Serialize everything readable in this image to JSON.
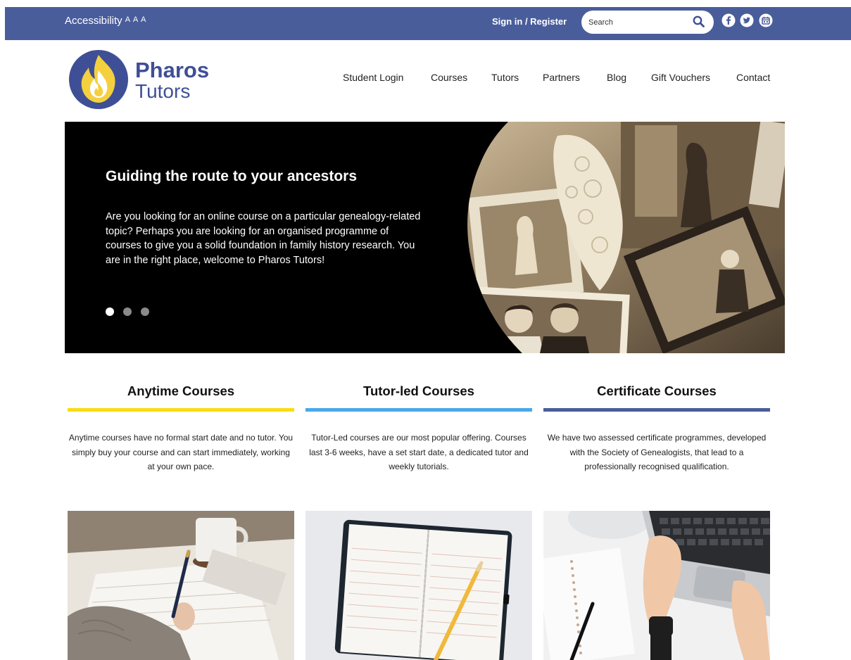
{
  "topbar": {
    "accessibility_label": "Accessibility",
    "font_size_options": "A A A",
    "signin_label": "Sign in / Register",
    "search_placeholder": "Search",
    "background": "#4a5d9b"
  },
  "social": [
    {
      "name": "facebook-icon"
    },
    {
      "name": "twitter-icon"
    },
    {
      "name": "calendar-icon"
    }
  ],
  "logo": {
    "line1": "Pharos",
    "line2": "Tutors",
    "brand_color": "#3f4f96",
    "flame_color": "#f4d03f"
  },
  "nav": {
    "items": [
      "Student Login",
      "Courses",
      "Tutors",
      "Partners",
      "Blog",
      "Gift Vouchers",
      "Contact"
    ]
  },
  "hero": {
    "title": "Guiding the route to your ancestors",
    "text": "Are you looking for an online course on a particular genealogy-related topic? Perhaps you are looking for an organised programme of courses to give you a solid foundation in family history research. You are in the right place, welcome to Pharos Tutors!",
    "slides_total": 3,
    "active_slide": 1
  },
  "courses": [
    {
      "title": "Anytime Courses",
      "color": "#fbdc10",
      "text": "Anytime courses have no formal start date and no tutor. You simply buy your course and can start immediately, working at your own pace."
    },
    {
      "title": "Tutor-led Courses",
      "color": "#4aa8ea",
      "text": "Tutor-Led courses are our most popular offering. Courses last 3-6 weeks, have a set start date, a dedicated tutor and weekly tutorials."
    },
    {
      "title": "Certificate Courses",
      "color": "#4a5d9b",
      "text": "We have two assessed certificate programmes, developed with the Society of Genealogists, that lead to a professionally recognised qualification."
    }
  ]
}
